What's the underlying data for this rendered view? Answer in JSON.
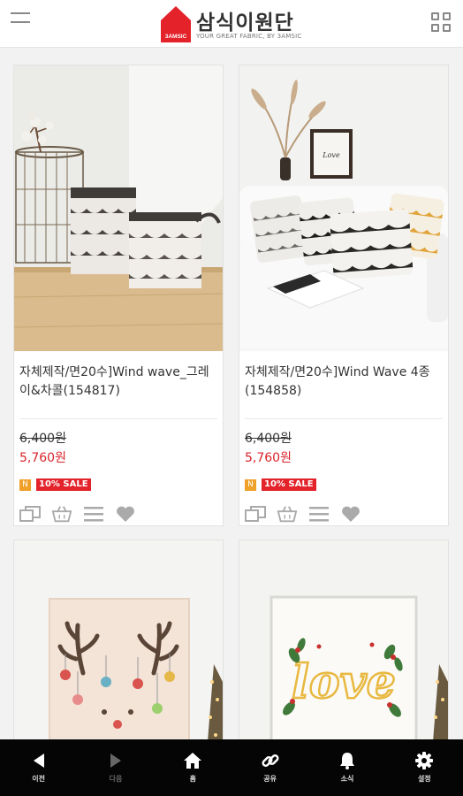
{
  "header": {
    "logo_text": "삼식이원단",
    "logo_mark_text": "3AMSIC",
    "logo_sub": "YOUR GREAT FABRIC, BY 3AMSIC"
  },
  "products": [
    {
      "name": "자체제작/면20수]Wind wave_그레이&차콜(154817)",
      "original_price": "6,400원",
      "sale_price": "5,760원",
      "badge_new": "N",
      "badge_sale": "10% SALE"
    },
    {
      "name": "자체제작/면20수]Wind Wave 4종(154858)",
      "original_price": "6,400원",
      "sale_price": "5,760원",
      "badge_new": "N",
      "badge_sale": "10% SALE"
    }
  ],
  "artwork_text": {
    "frame_script": "Love",
    "card_love": "love"
  },
  "bottom_nav": [
    {
      "label": "이전",
      "icon": "back-icon"
    },
    {
      "label": "다음",
      "icon": "forward-icon"
    },
    {
      "label": "홈",
      "icon": "home-icon"
    },
    {
      "label": "공유",
      "icon": "link-icon"
    },
    {
      "label": "소식",
      "icon": "bell-icon"
    },
    {
      "label": "설정",
      "icon": "gear-icon"
    }
  ],
  "colors": {
    "accent": "#d9232a",
    "nav_bg": "#050505",
    "badge_new": "#f0a12a"
  }
}
